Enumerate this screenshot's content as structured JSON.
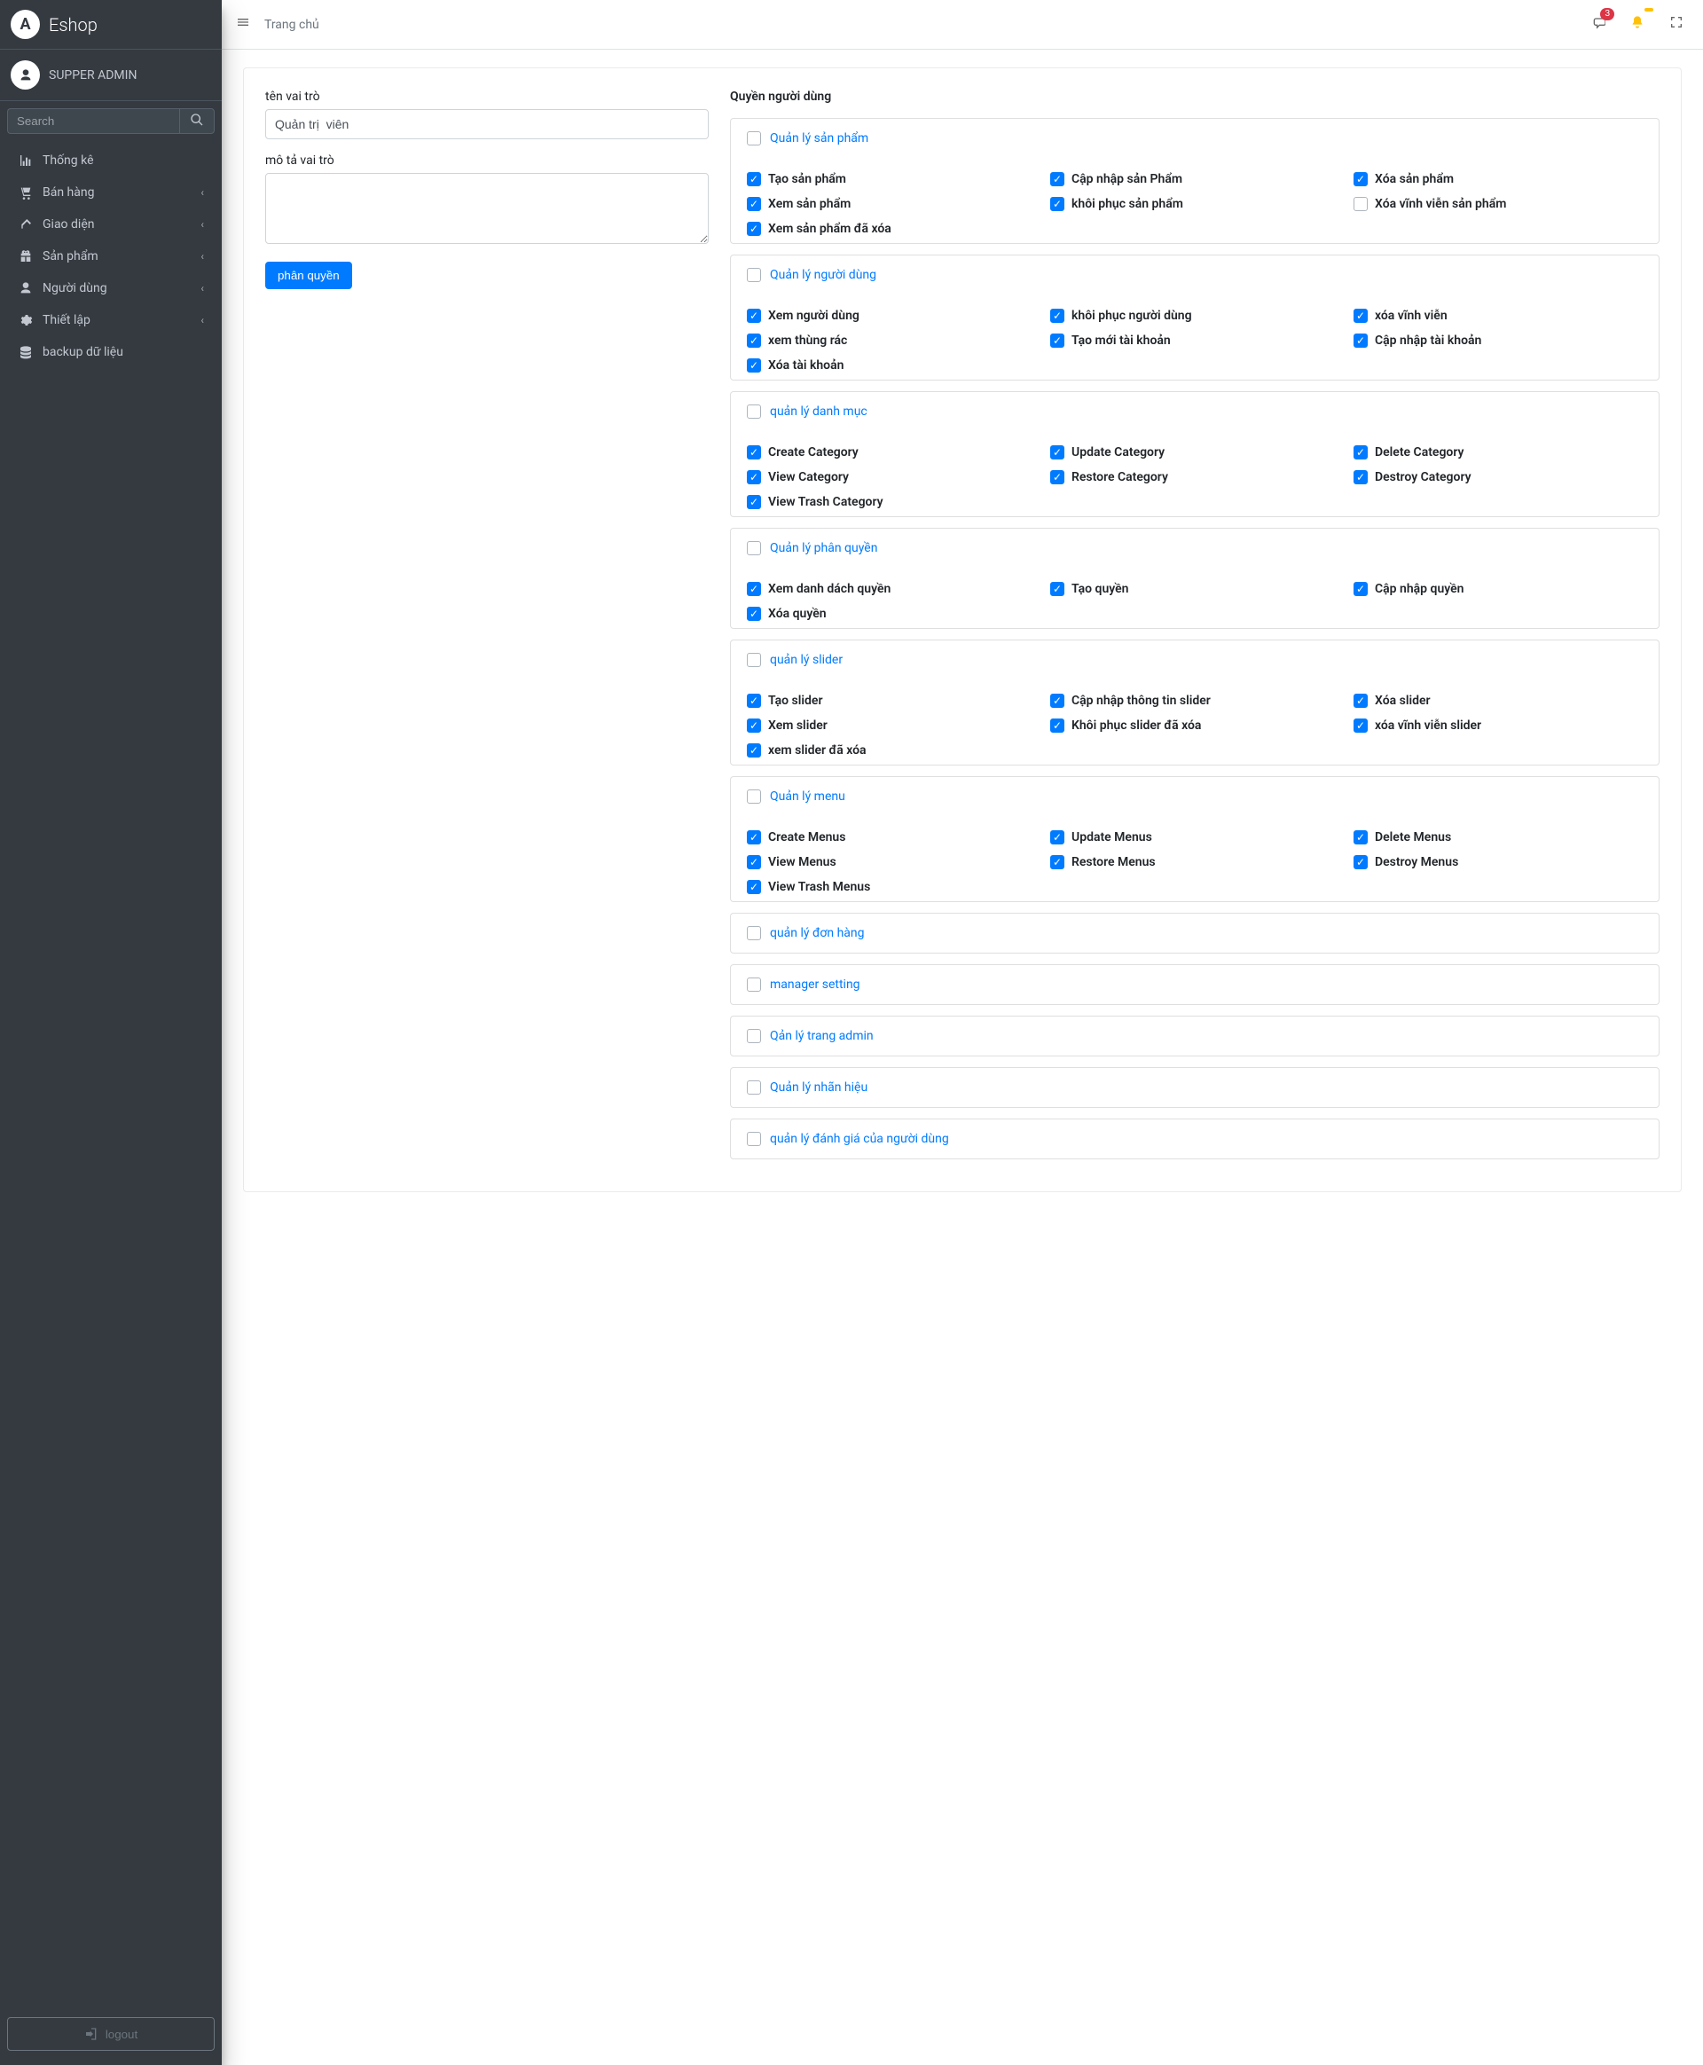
{
  "brand": {
    "name": "Eshop",
    "logo_letter": "A"
  },
  "user": {
    "name": "SUPPER ADMIN"
  },
  "search": {
    "placeholder": "Search"
  },
  "sidebar": {
    "items": [
      {
        "icon": "chart-icon",
        "label": "Thống kê",
        "has_children": false
      },
      {
        "icon": "cart-icon",
        "label": "Bán hàng",
        "has_children": true
      },
      {
        "icon": "brush-icon",
        "label": "Giao diện",
        "has_children": true
      },
      {
        "icon": "gift-icon",
        "label": "Sản phẩm",
        "has_children": true
      },
      {
        "icon": "user-icon",
        "label": "Người dùng",
        "has_children": true
      },
      {
        "icon": "gear-icon",
        "label": "Thiết lập",
        "has_children": true
      },
      {
        "icon": "database-icon",
        "label": "backup dữ liệu",
        "has_children": false
      }
    ],
    "logout_label": "logout"
  },
  "topbar": {
    "breadcrumb": "Trang chủ",
    "chat_badge": "3",
    "bell_badge": ""
  },
  "form": {
    "role_name_label": "tên vai trò",
    "role_name_value": "Quản trị  viên",
    "role_desc_label": "mô tả vai trò",
    "role_desc_value": "",
    "submit_label": "phân quyền"
  },
  "permissions_title": "Quyền người dùng",
  "groups": [
    {
      "id": "grp-products",
      "label": "Quản lý sản phẩm",
      "parent_checked": false,
      "expanded": true,
      "perms": [
        {
          "label": "Tạo sản phẩm",
          "checked": true
        },
        {
          "label": "Cập nhập sản Phẩm",
          "checked": true
        },
        {
          "label": "Xóa sản phẩm",
          "checked": true
        },
        {
          "label": "Xem sản phẩm",
          "checked": true
        },
        {
          "label": "khôi phục sản phẩm",
          "checked": true
        },
        {
          "label": "Xóa vĩnh viễn sản phẩm",
          "checked": false
        },
        {
          "label": "Xem sản phẩm đã xóa",
          "checked": true
        }
      ]
    },
    {
      "id": "grp-users",
      "label": "Quản lý người dùng",
      "parent_checked": false,
      "expanded": true,
      "perms": [
        {
          "label": "Xem người dùng",
          "checked": true
        },
        {
          "label": "khôi phục người dùng",
          "checked": true
        },
        {
          "label": "xóa vĩnh viễn",
          "checked": true
        },
        {
          "label": "xem thùng rác",
          "checked": true
        },
        {
          "label": "Tạo mới tài khoản",
          "checked": true
        },
        {
          "label": "Cập nhập tài khoản",
          "checked": true
        },
        {
          "label": "Xóa tài khoản",
          "checked": true
        }
      ]
    },
    {
      "id": "grp-category",
      "label": "quản lý danh mục",
      "parent_checked": false,
      "expanded": true,
      "perms": [
        {
          "label": "Create Category",
          "checked": true
        },
        {
          "label": "Update Category",
          "checked": true
        },
        {
          "label": "Delete Category",
          "checked": true
        },
        {
          "label": "View Category",
          "checked": true
        },
        {
          "label": "Restore Category",
          "checked": true
        },
        {
          "label": "Destroy Category",
          "checked": true
        },
        {
          "label": "View Trash Category",
          "checked": true
        }
      ]
    },
    {
      "id": "grp-perm",
      "label": "Quản lý phân quyền",
      "parent_checked": false,
      "expanded": true,
      "perms": [
        {
          "label": "Xem danh dách quyền",
          "checked": true
        },
        {
          "label": "Tạo quyền",
          "checked": true
        },
        {
          "label": "Cập nhập quyền",
          "checked": true
        },
        {
          "label": "Xóa quyền",
          "checked": true
        }
      ]
    },
    {
      "id": "grp-slider",
      "label": "quản lý slider",
      "parent_checked": false,
      "expanded": true,
      "perms": [
        {
          "label": "Tạo slider",
          "checked": true
        },
        {
          "label": "Cập nhập thông tin slider",
          "checked": true
        },
        {
          "label": "Xóa slider",
          "checked": true
        },
        {
          "label": "Xem slider",
          "checked": true
        },
        {
          "label": "Khôi phục slider đã xóa",
          "checked": true
        },
        {
          "label": "xóa vĩnh viễn slider",
          "checked": true
        },
        {
          "label": "xem slider đã xóa",
          "checked": true
        }
      ]
    },
    {
      "id": "grp-menu",
      "label": "Quản lý menu",
      "parent_checked": false,
      "expanded": true,
      "perms": [
        {
          "label": "Create Menus",
          "checked": true
        },
        {
          "label": "Update Menus",
          "checked": true
        },
        {
          "label": "Delete Menus",
          "checked": true
        },
        {
          "label": "View Menus",
          "checked": true
        },
        {
          "label": "Restore Menus",
          "checked": true
        },
        {
          "label": "Destroy Menus",
          "checked": true
        },
        {
          "label": "View Trash Menus",
          "checked": true
        }
      ]
    },
    {
      "id": "grp-order",
      "label": "quản lý đơn hàng",
      "parent_checked": false,
      "expanded": false,
      "perms": []
    },
    {
      "id": "grp-setting",
      "label": "manager setting",
      "parent_checked": false,
      "expanded": false,
      "perms": []
    },
    {
      "id": "grp-admin",
      "label": "Qản lý trang admin",
      "parent_checked": false,
      "expanded": false,
      "perms": []
    },
    {
      "id": "grp-brand",
      "label": "Quản lý nhãn hiệu",
      "parent_checked": false,
      "expanded": false,
      "perms": []
    },
    {
      "id": "grp-review",
      "label": "quản lý đánh giá của người dùng",
      "parent_checked": false,
      "expanded": false,
      "perms": []
    }
  ]
}
